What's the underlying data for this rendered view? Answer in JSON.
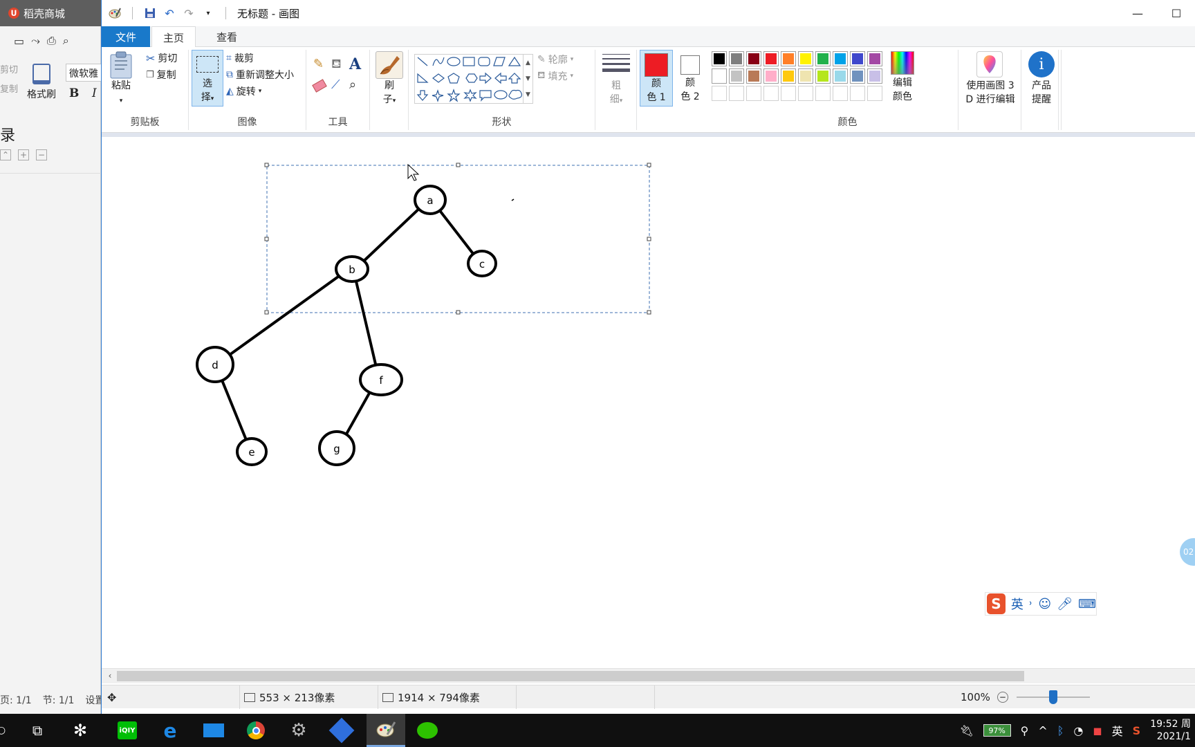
{
  "background_window": {
    "title": "稻壳商城",
    "cut_label": "剪切",
    "copy_label": "复制",
    "format_brush_label": "格式刷",
    "font_name": "微软雅",
    "bold_label": "B",
    "italic_label": "I",
    "toc_title": "录",
    "status_page": "页: 1/1",
    "status_section": "节: 1/1",
    "status_settings": "设置"
  },
  "paint": {
    "window_title": "无标题 - 画图",
    "tabs": [
      {
        "label": "文件",
        "selected": false,
        "style": "file"
      },
      {
        "label": "主页",
        "selected": true
      },
      {
        "label": "查看",
        "selected": false
      }
    ],
    "clipboard": {
      "group_label": "剪贴板",
      "paste_label": "粘贴",
      "cut_label": "剪切",
      "copy_label": "复制"
    },
    "image": {
      "group_label": "图像",
      "select_label_1": "选",
      "select_label_2": "择",
      "crop_label": "裁剪",
      "resize_label": "重新调整大小",
      "rotate_label": "旋转"
    },
    "tools": {
      "group_label": "工具",
      "items": [
        "pencil-icon",
        "fill-icon",
        "text-icon",
        "eraser-icon",
        "color-picker-icon",
        "magnifier-icon"
      ]
    },
    "brushes": {
      "label_1": "刷",
      "label_2": "子"
    },
    "shapes": {
      "group_label": "形状",
      "outline_label": "轮廓",
      "fill_label": "填充"
    },
    "size": {
      "label_1": "粗",
      "label_2": "细"
    },
    "colors": {
      "group_label": "颜色",
      "color1_label_1": "颜",
      "color1_label_2": "色 1",
      "color2_label_1": "颜",
      "color2_label_2": "色 2",
      "color1_value": "#ed1c24",
      "color2_value": "#ffffff",
      "edit_colors_label_1": "编辑",
      "edit_colors_label_2": "颜色",
      "palette_row1": [
        "#000000",
        "#7f7f7f",
        "#880015",
        "#ed1c24",
        "#ff7f27",
        "#fff200",
        "#22b14c",
        "#00a2e8",
        "#3f48cc",
        "#a349a4"
      ],
      "palette_row2": [
        "#ffffff",
        "#c3c3c3",
        "#b97a57",
        "#ffaec9",
        "#ffc90e",
        "#efe4b0",
        "#b5e61d",
        "#99d9ea",
        "#7092be",
        "#c8bfe7"
      ],
      "palette_row3": [
        "",
        "",
        "",
        "",
        "",
        "",
        "",
        "",
        "",
        ""
      ]
    },
    "paint3d": {
      "label_1": "使用画图 3",
      "label_2": "D 进行编辑"
    },
    "product_alert": {
      "label_1": "产品",
      "label_2": "提醒"
    },
    "tree": {
      "nodes": [
        {
          "label": "a"
        },
        {
          "label": "b"
        },
        {
          "label": "c"
        },
        {
          "label": "d"
        },
        {
          "label": "f"
        },
        {
          "label": "e"
        },
        {
          "label": "g"
        }
      ],
      "edges": [
        [
          "a",
          "b"
        ],
        [
          "a",
          "c"
        ],
        [
          "b",
          "d"
        ],
        [
          "b",
          "f"
        ],
        [
          "d",
          "e"
        ],
        [
          "f",
          "g"
        ]
      ]
    },
    "status": {
      "selection_size": "553 × 213像素",
      "image_size": "1914 × 794像素",
      "zoom": "100%",
      "zoom_level": 1.0
    }
  },
  "ime": {
    "logo": "S",
    "mode": "英"
  },
  "bubble_text": "02",
  "taskbar": {
    "apps": [
      "task-view-icon",
      "pinwheel-app-icon",
      "iqiyi-icon",
      "edge-icon",
      "mail-icon",
      "chrome-icon",
      "settings-app-icon",
      "sogou-app-icon",
      "paint-app-icon",
      "wechat-icon"
    ],
    "battery": "97%",
    "ime_lang": "英",
    "time": "19:52 周",
    "date": "2021/1"
  }
}
